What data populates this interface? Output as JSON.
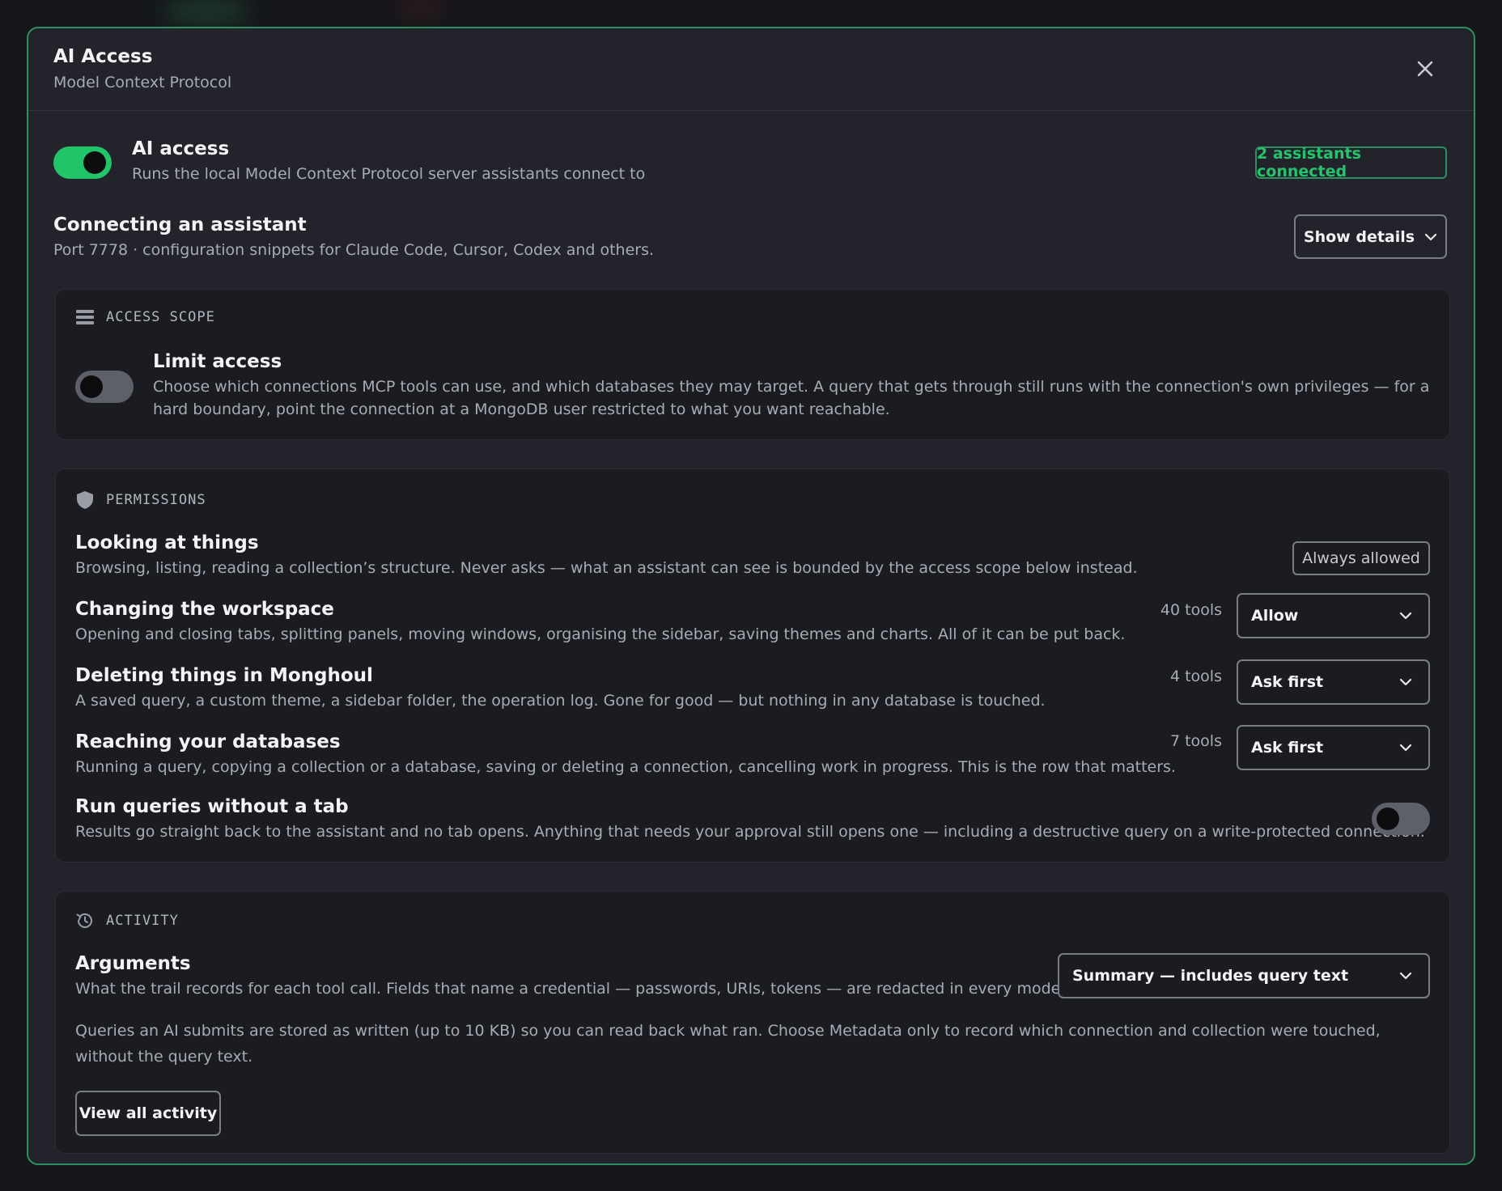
{
  "modal": {
    "title": "AI Access",
    "subtitle": "Model Context Protocol"
  },
  "ai_access": {
    "title": "AI access",
    "description": "Runs the local Model Context Protocol server assistants connect to",
    "enabled": true,
    "status_badge": "2 assistants connected"
  },
  "connecting": {
    "title": "Connecting an assistant",
    "description": "Port 7778 · configuration snippets for Claude Code, Cursor, Codex and others.",
    "details_button": "Show details"
  },
  "access_scope": {
    "section_label": "ACCESS SCOPE",
    "limit_title": "Limit access",
    "limit_description": "Choose which connections MCP tools can use, and which databases they may target. A query that gets through still runs with the connection's own privileges — for a hard boundary, point the connection at a MongoDB user restricted to what you want reachable.",
    "limit_enabled": false
  },
  "permissions": {
    "section_label": "PERMISSIONS",
    "looking": {
      "title": "Looking at things",
      "description": "Browsing, listing, reading a collection’s structure. Never asks — what an assistant can see is bounded by the access scope below instead.",
      "badge": "Always allowed"
    },
    "workspace": {
      "title": "Changing the workspace",
      "description": "Opening and closing tabs, splitting panels, moving windows, organising the sidebar, saving themes and charts. All of it can be put back.",
      "tools": "40 tools",
      "value": "Allow"
    },
    "deleting": {
      "title": "Deleting things in Monghoul",
      "description": "A saved query, a custom theme, a sidebar folder, the operation log. Gone for good — but nothing in any database is touched.",
      "tools": "4 tools",
      "value": "Ask first"
    },
    "databases": {
      "title": "Reaching your databases",
      "description": "Running a query, copying a collection or a database, saving or deleting a connection, cancelling work in progress. This is the row that matters.",
      "tools": "7 tools",
      "value": "Ask first"
    },
    "no_tab": {
      "title": "Run queries without a tab",
      "description": "Results go straight back to the assistant and no tab opens. Anything that needs your approval still opens one — including a destructive query on a write-protected connection.",
      "enabled": false
    }
  },
  "activity": {
    "section_label": "ACTIVITY",
    "arguments_title": "Arguments",
    "arguments_description": "What the trail records for each tool call. Fields that name a credential — passwords, URIs, tokens — are redacted in every mode.",
    "arguments_value": "Summary — includes query text",
    "note": "Queries an AI submits are stored as written (up to 10 KB) so you can read back what ran. Choose Metadata only to record which connection and collection were touched, without the query text.",
    "view_all_button": "View all activity"
  },
  "colors": {
    "accent_green": "#22c46a",
    "border_green": "#2f8f62",
    "modal_bg": "#22232b",
    "card_bg": "#1b1c22"
  },
  "icons": [
    "close-icon",
    "chevron-down-icon",
    "server-stack-icon",
    "shield-icon",
    "history-icon"
  ]
}
